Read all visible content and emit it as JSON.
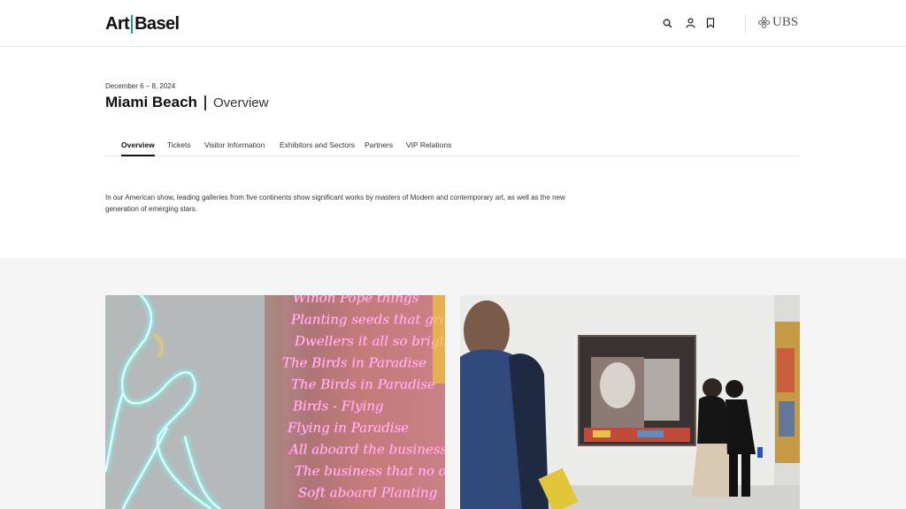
{
  "header": {
    "logo_left": "Art",
    "logo_right": "Basel",
    "icons": [
      "search-icon",
      "user-icon",
      "bookmark-icon"
    ],
    "partner": "UBS",
    "accent_color": "#1a9e9a"
  },
  "event": {
    "date": "December 6 – 8, 2024",
    "city": "Miami Beach",
    "section": "Overview"
  },
  "tabs": [
    {
      "label": "Overview",
      "active": true
    },
    {
      "label": "Tickets",
      "active": false
    },
    {
      "label": "Visitor Information",
      "active": false
    },
    {
      "label": "Exhibitors and Sectors",
      "active": false
    },
    {
      "label": "Partners",
      "active": false
    },
    {
      "label": "VIP Relations",
      "active": false
    }
  ],
  "intro": "In our American show, leading galleries from five continents show significant works by masters of Modern and contemporary art, as well as the new generation of emerging stars.",
  "neon_lines": [
    "Winon Pope things",
    "Planting seeds that grow",
    "Dwellers it all so bright",
    "The Birds in Paradise",
    "The Birds in Paradise",
    "Birds - Flying",
    "Flying in Paradise",
    "All aboard the business",
    "The business that no one",
    "Soft aboard Planting"
  ]
}
